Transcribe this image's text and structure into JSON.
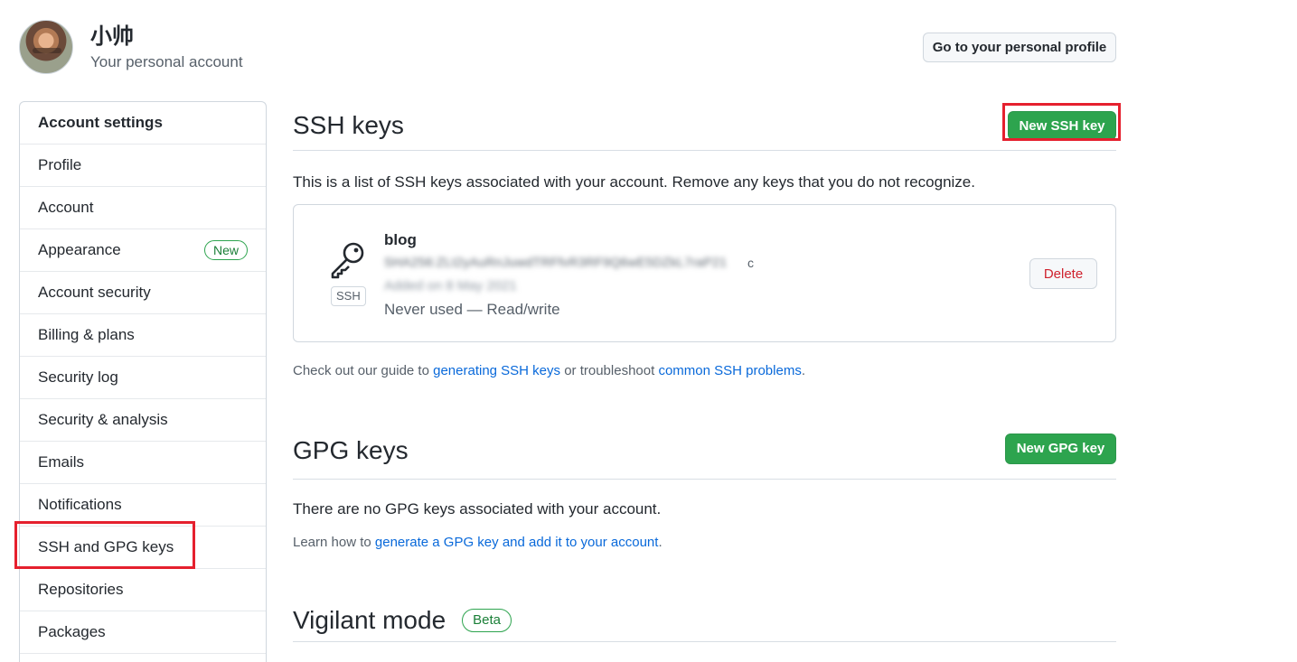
{
  "header": {
    "user_name": "小帅",
    "user_sub": "Your personal account",
    "profile_button": "Go to your personal profile"
  },
  "sidebar": {
    "heading": "Account settings",
    "items": [
      {
        "label": "Profile"
      },
      {
        "label": "Account"
      },
      {
        "label": "Appearance",
        "badge": "New"
      },
      {
        "label": "Account security"
      },
      {
        "label": "Billing & plans"
      },
      {
        "label": "Security log"
      },
      {
        "label": "Security & analysis"
      },
      {
        "label": "Emails"
      },
      {
        "label": "Notifications"
      },
      {
        "label": "SSH and GPG keys"
      },
      {
        "label": "Repositories"
      },
      {
        "label": "Packages"
      }
    ]
  },
  "ssh": {
    "title": "SSH keys",
    "new_button": "New SSH key",
    "intro": "This is a list of SSH keys associated with your account. Remove any keys that you do not recognize.",
    "key": {
      "icon": "key-icon",
      "tag": "SSH",
      "title": "blog",
      "fingerprint": "SHA256:ZLt2yAuRnJuwdTRFfvR3RF9Q6wE5DZkL7raP21",
      "fingerprint_end": "c",
      "added": "Added on 8 May 2021",
      "usage": "Never used — Read/write",
      "delete_button": "Delete"
    },
    "guide_prefix": "Check out our guide to ",
    "guide_link1": "generating SSH keys",
    "guide_mid": " or troubleshoot ",
    "guide_link2": "common SSH problems",
    "guide_suffix": "."
  },
  "gpg": {
    "title": "GPG keys",
    "new_button": "New GPG key",
    "none_text": "There are no GPG keys associated with your account.",
    "learn_prefix": "Learn how to ",
    "learn_link": "generate a GPG key and add it to your account",
    "learn_suffix": "."
  },
  "vigilant": {
    "title": "Vigilant mode",
    "badge": "Beta"
  },
  "colors": {
    "green": "#2da44e",
    "link": "#0969da",
    "danger": "#cf222e",
    "highlight": "#e5202e"
  }
}
